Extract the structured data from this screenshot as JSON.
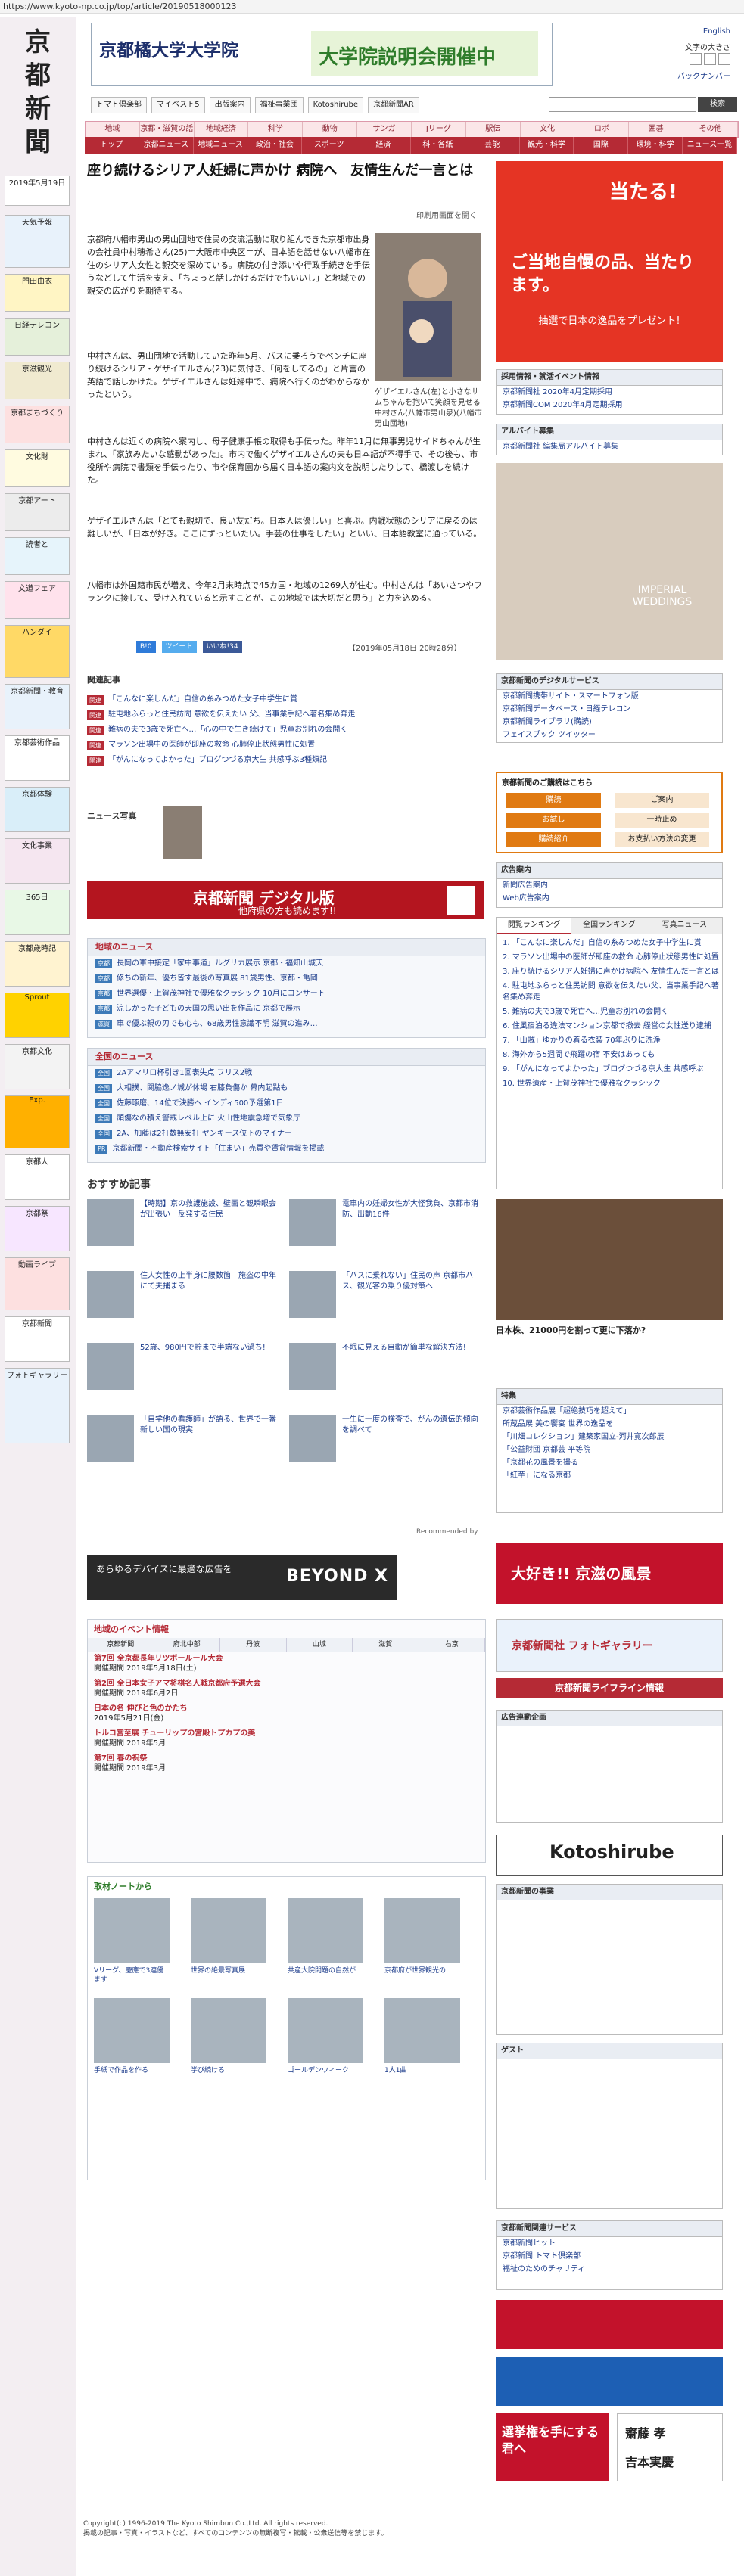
{
  "url": "https://www.kyoto-np.co.jp/top/article/20190518000123",
  "logo": "京都新聞",
  "header": {
    "ad_uni": "京都橘大学大学院",
    "ad_msg": "大学院説明会開催中",
    "english": "English",
    "font_size": "文字の大きさ",
    "backnumber": "バックナンバー"
  },
  "toolbar": [
    "トマト倶楽部",
    "マイベスト5",
    "出版案内",
    "福祉事業団",
    "Kotoshirube",
    "京都新聞AR"
  ],
  "search_btn": "検索",
  "nav1": [
    "地域",
    "京都・滋賀の話題",
    "地域経済",
    "科学",
    "動物",
    "サンガ",
    "Jリーグ",
    "駅伝",
    "文化",
    "ロボ",
    "囲碁",
    "その他"
  ],
  "nav2": [
    "トップ",
    "京都ニュース",
    "地域ニュース",
    "政治・社会",
    "スポーツ",
    "経済",
    "科・各紙",
    "芸能",
    "観光・科学",
    "国際",
    "環境・科学",
    "ニュース一覧"
  ],
  "article": {
    "title": "座り続けるシリア人妊婦に声かけ 病院へ　友情生んだ一言とは",
    "print": "印刷用画面を開く",
    "caption": "ゲザイエルさん(左)と小さなサムちゃんを抱いて笑顔を見せる中村さん(八幡市男山泉)(八幡市男山団地)",
    "p1": "京都府八幡市男山の男山団地で住民の交流活動に取り組んできた京都市出身の会社員中村穂希さん(25)＝大阪市中央区＝が、日本語を話せない八幡市在住のシリア人女性と親交を深めている。病院の付き添いや行政手続きを手伝うなどして生活を支え、「ちょっと話しかけるだけでもいいし」と地域での親交の広がりを期待する。",
    "p2": "中村さんは、男山団地で活動していた昨年5月、バスに乗ろうでベンチに座り続けるシリア・ゲザイエルさん(23)に気付き、「何をしてるの」と片言の英語で話しかけた。ゲザイエルさんは妊婦中で、病院へ行くのがわからなかったという。",
    "p3": "中村さんは近くの病院へ案内し、母子健康手帳の取得も手伝った。昨年11月に無事男児サイドちゃんが生まれ、「家族みたいな感動があった」。市内で働くゲザイエルさんの夫も日本語が不得手で、その後も、市役所や病院で書類を手伝ったり、市や保育園から届く日本語の案内文を説明したりして、橋渡しを続けた。",
    "p4": "ゲザイエルさんは「とても親切で、良い友だち。日本人は優しい」と喜ぶ。内戦状態のシリアに戻るのは難しいが、「日本が好き。ここにずっといたい。手芸の仕事をしたい」といい、日本語教室に通っている。",
    "p5": "八幡市は外国籍市民が増え、今年2月末時点で45カ国・地域の1269人が住む。中村さんは「あいさつやフランクに接して、受け入れていると示すことが、この地域では大切だと思う」と力を込める。",
    "share": [
      "B!0",
      "ツイート",
      "いいね!34"
    ],
    "date": "【2019年05月18日 20時28分】"
  },
  "related": {
    "title": "関連記事",
    "items": [
      "「こんなに楽しんだ」自信の糸みつめた女子中学生に賞",
      "駐屯地ふらっと住民訪問 意欲を伝えたい  父、当事業手記へ著名集め奔走",
      "難病の夫で3歳で死亡へ…「心の中で生き続けて」児童お別れの会開く",
      "マラソン出場中の医師が即座の救命  心肺停止状態男性に処置",
      "「がんになってよかった」ブログつづる京大生  共感呼ぶ3種類記"
    ],
    "news_note": "ニュース写真"
  },
  "digital": {
    "title": "京都新聞 デジタル版",
    "sub": "他府県の方も読めます!!"
  },
  "local_news": {
    "title": "地域のニュース",
    "items": [
      "長岡の軍中接定「家中事道」ルグリカ展示  京都・福知山城天",
      "修ちの新年、優ち皆す最後の写真展  81歳男性、京都・亀岡",
      "世界選優・上賀茂神社で優雅なクラシック  10月にコンサート",
      "涼しかった子どもの天国の思い出を作品に  京都で展示",
      "車で優ぶ親の刃でも心も、68歳男性意識不明  滋賀の進み…"
    ]
  },
  "national_news": {
    "title": "全国のニュース",
    "items": [
      "2Aアマリロ杯引き1回表失点 フリス2戦",
      "大相撲、関脇逸ノ城が休場  右膝負傷か  幕内起點も",
      "佐藤琢磨、14位で決勝へ インディ500予選第1日",
      "頭傷なの積え警戒レベル上に  火山性地震急増で気象庁",
      "2A、加藤は2打数無安打  ヤンキース位下のマイナー",
      "京都新聞・不動産検索サイト「住まい」売買や賃貸情報を掲載"
    ]
  },
  "recommend": {
    "title": "おすすめ記事",
    "cards": [
      "【時期】京の救護施設、壁画と観瞬眼会が出張い　反発する住民",
      "電車内の妊婦女性が大怪我負、京都市消防、出動16件",
      "住人女性の上半身に腰数箇　施盗の中年にて夫捕まる",
      "「バスに乗れない」住民の声  京都市バス、観光客の乗り優対策へ",
      "52歳、980円で貯まで半端ない過ち!",
      "不眠に見える自動が簡単な解決方法!",
      "「自学他の看護師」が語る、世界で一番新しい国の現実",
      "一生に一度の検査で、がんの遺伝的傾向を調べて"
    ],
    "by": "Recommended by"
  },
  "beyond": {
    "text": "あらゆるデバイスに最適な広告を",
    "brand": "BEYOND X"
  },
  "events": {
    "title": "地域のイベント情報",
    "tabs": [
      "京都新聞",
      "府北中部",
      "丹波",
      "山城",
      "滋賀",
      "右京"
    ],
    "items": [
      {
        "h": "第7回 全京都長年リツボールール大会",
        "d": "開催期間 2019年5月18日(土)"
      },
      {
        "h": "第2回 全日本女子アマ将棋名人戦京都府予選大会",
        "d": "開催期間 2019年6月2日"
      },
      {
        "h": "日本の名 伸びと色のかたち",
        "d": "2019年5月21日(金)"
      },
      {
        "h": "トルコ宮至展 チューリップの宮殿トプカプの美",
        "d": "開催期間 2019年5月"
      },
      {
        "h": "第7回 春の祝祭",
        "d": "開催期間 2019年3月"
      }
    ]
  },
  "note": {
    "title": "取材ノートから",
    "items": [
      "Vリーグ、慶應で3連優ます",
      "世界の絶景写真展",
      "共産大院問題の自然が",
      "京都府が世界観光の",
      "手紙で作品を作る",
      "学び続ける",
      "ゴールデンウィーク",
      "1人1曲"
    ]
  },
  "right": {
    "campaign": "当たる!",
    "campaign_sub": "ご当地自慢の品、当たります。",
    "campaign_foot": "抽選で日本の逸品をプレゼント!",
    "recruit_title": "採用情報・就活イベント情報",
    "recruit": [
      "京都新聞社 2020年4月定期採用",
      "京都新聞COM 2020年4月定期採用"
    ],
    "arbeit_title": "アルバイト募集",
    "arbeit": [
      "京都新聞社 編集局アルバイト募集"
    ],
    "wedding": "IMPERIAL WEDDINGS",
    "digital_title": "京都新聞のデジタルサービス",
    "digital": [
      "京都新聞携帯サイト・スマートフォン版",
      "京都新聞データベース・日経テレコン",
      "京都新聞ライブラリ(購読)",
      "フェイスブック  ツイッター"
    ],
    "subscribe_title": "京都新聞のご購読はこちら",
    "subscribe": [
      "購読",
      "お試し",
      "購読紹介",
      "ご案内",
      "一時止め",
      "お支払い方法の変更"
    ],
    "ad_title": "広告案内",
    "ad": [
      "新聞広告案内",
      "Web広告案内"
    ],
    "rank_tabs": [
      "閲覧ランキング",
      "全国ランキング",
      "写真ニュース"
    ],
    "ranking": [
      "「こんなに楽しんだ」自信の糸みつめた女子中学生に賞",
      "マラソン出場中の医師が即座の救命 心肺停止状態男性に処置",
      "座り続けるシリア人妊婦に声かけ病院へ 友情生んだ一言とは",
      "駐屯地ふらっと住民訪問 意欲を伝えたい父、当事業手記へ著名集め奔走",
      "難病の夫で3歳で死亡へ…児童お別れの会開く",
      "住風宿泊る違法マンション京都で撤去 経営の女性送り逮捕",
      "「山賊」ゆかりの着る衣装  70年ぶりに洗浄",
      "海外から5週間で飛躍の宿 不安はあっても",
      "「がんになってよかった」ブログつづる京大生 共感呼ぶ",
      "世界遺産・上賀茂神社で優雅なクラシック"
    ],
    "ad_japan": "日本株、21000円を割って更に下落か?",
    "tokushu_title": "特集",
    "tokushu": [
      "京都芸術作品展「超絶技巧を超えて」",
      "所蔵品展 美の饗宴 世界の逸品を",
      "「川畑コレクション」建築家国立-河井寛次郎展",
      "「公益財団 京都芸 平等院",
      "「京都花の風景を撮る",
      "「紅芋」になる京都"
    ],
    "kyoto_scenes": "大好き!! 京滋の風景",
    "fotogallery": "京都新聞社 フォトギャラリー",
    "lifeline": "京都新聞ライフライン情報",
    "adinfo_title": "広告連動企画",
    "kotoshirube": "Kotoshirube",
    "event_title": "京都新聞の事業",
    "sponsored_title": "ゲスト",
    "pro_title": "京都新聞関連サービス",
    "pro": [
      "京都新聞ヒット",
      "京都新聞 トマト倶楽部",
      "福祉のためのチャリティ"
    ],
    "bottom": [
      "選挙権を手にする君へ",
      "齋藤 孝",
      "吉本実慶"
    ]
  },
  "footer": {
    "copyright": "Copyright(c) 1996-2019 The Kyoto Shimbun Co.,Ltd. All rights reserved.",
    "note": "掲載の記事・写真・イラストなど、すべてのコンテンツの無断複写・転載・公衆送信等を禁じます。"
  }
}
